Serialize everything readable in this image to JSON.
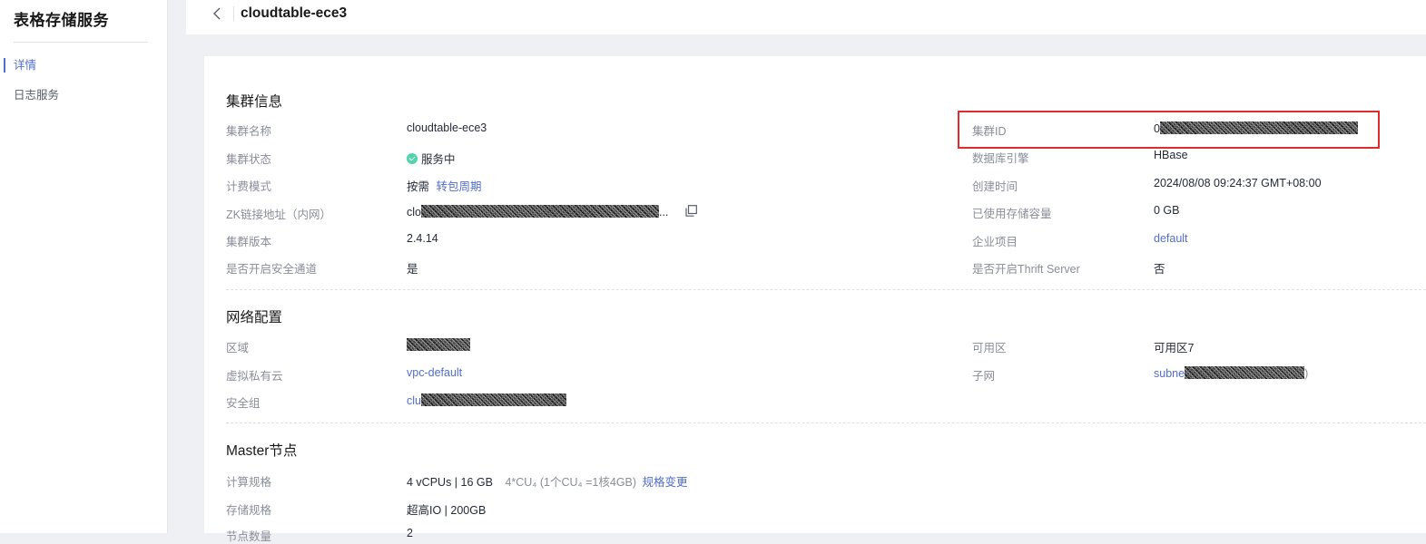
{
  "sidebar": {
    "title": "表格存储服务",
    "items": [
      {
        "label": "详情",
        "active": true
      },
      {
        "label": "日志服务",
        "active": false
      }
    ]
  },
  "header": {
    "title": "cloudtable-ece3"
  },
  "cluster_info": {
    "section_title": "集群信息",
    "name_label": "集群名称",
    "name_value": "cloudtable-ece3",
    "status_label": "集群状态",
    "status_value": "服务中",
    "billing_label": "计费模式",
    "billing_value": "按需",
    "billing_action": "转包周期",
    "zk_label": "ZK链接地址（内网）",
    "zk_prefix": "clo",
    "zk_suffix": "...",
    "version_label": "集群版本",
    "version_value": "2.4.14",
    "secure_label": "是否开启安全通道",
    "secure_value": "是",
    "id_label": "集群ID",
    "id_prefix": "0",
    "engine_label": "数据库引擎",
    "engine_value": "HBase",
    "created_label": "创建时间",
    "created_value": "2024/08/08 09:24:37 GMT+08:00",
    "storage_used_label": "已使用存储容量",
    "storage_used_value": "0 GB",
    "project_label": "企业项目",
    "project_value": "default",
    "thrift_label": "是否开启Thrift Server",
    "thrift_value": "否"
  },
  "network": {
    "section_title": "网络配置",
    "region_label": "区域",
    "vpc_label": "虚拟私有云",
    "vpc_value": "vpc-default",
    "sg_label": "安全组",
    "sg_prefix": "clu",
    "az_label": "可用区",
    "az_value": "可用区7",
    "subnet_label": "子网",
    "subnet_prefix": "subne",
    "subnet_suffix": ")"
  },
  "master": {
    "section_title": "Master节点",
    "compute_label": "计算规格",
    "compute_value": "4 vCPUs | 16 GB",
    "compute_cu": "4*CU₄ (1个CU₄ =1核4GB)",
    "compute_action": "规格变更",
    "storage_label": "存储规格",
    "storage_value": "超高IO | 200GB",
    "nodes_label": "节点数量",
    "nodes_value": "2"
  },
  "colors": {
    "accent": "#526ecc",
    "status_ok": "#50d4ab",
    "highlight": "#e02c2c"
  }
}
